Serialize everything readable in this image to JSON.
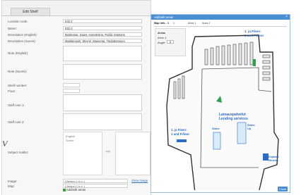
{
  "tab": {
    "label": "Edit Shelf"
  },
  "form": {
    "location_code_label": "Location code:",
    "location_code_value": "032.2",
    "name_label": "Name:",
    "name_value": "032.2",
    "desc_en_label": "Description (English):",
    "desc_en_value": "Marketing, Sales, Advertising, Public relations",
    "desc_fi_label": "Description (Suomi):",
    "desc_fi_value": "Markkinointi, Myynti, Mainonta, Tiedottaminen",
    "note_en_label": "Note (English):",
    "note_fi_label": "Note (Suomi):",
    "shelf_number_label": "Shelf number:",
    "floor_label": "Floor:",
    "staff_note1_label": "Staff note 1:",
    "staff_note2_label": "Staff note 2:",
    "subject_label": "Subject matter:",
    "subject_en": "English",
    "subject_fi": "Suomi",
    "image_label": "Image:",
    "image_value": "(Version 1 h.n. )",
    "map_label": "Map:",
    "map_value": "(Version 1 h.n. )",
    "show_image": "Show image",
    "add_areas": "Add/edit areas",
    "side_mark": "V"
  },
  "modal": {
    "title": "Add/edit areas",
    "close_x": "×",
    "tabs": [
      "Map info - 1",
      "1",
      "Area 1",
      "Area 2"
    ],
    "ctrl_title": "Areas",
    "ctrl_area_label": "Area: 1",
    "ctrl_angle_label": "Angle:",
    "ctrl_angle_value": "0",
    "close_button": "Close"
  },
  "map": {
    "label_top_right_1": "1. ja P.kerr.",
    "label_top_right_2": "1 and P.floor",
    "lending_1": "Lainauspalvelut",
    "lending_2": "Lending services",
    "label_left_1": "1. ja P.kerr.",
    "label_left_2": "1 and P.floor",
    "stairs_1": "Stairs",
    "stairs_2": "Stairs",
    "stairs_3": "Up",
    "elevator_1": "Kirjastot",
    "elevator_2": "libraries",
    "accent": "#2b6cc9"
  }
}
